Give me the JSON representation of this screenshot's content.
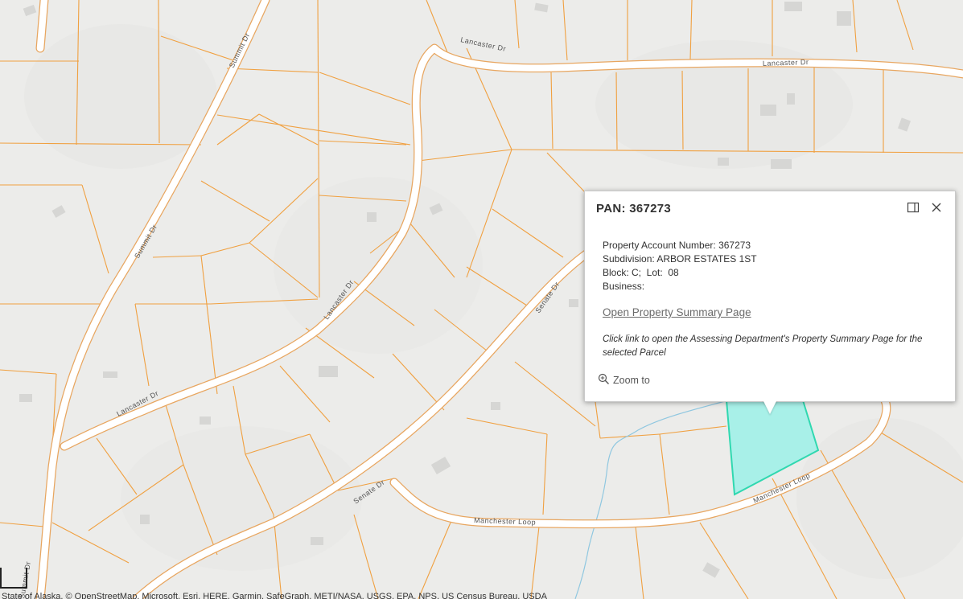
{
  "map": {
    "roads": {
      "summit_dr_upper": "Summit Dr",
      "summit_dr_lower": "Summit Dr",
      "summit_dr_bottom": "Summit Dr",
      "lancaster_dr_top_left": "Lancaster Dr",
      "lancaster_dr_top_right": "Lancaster Dr",
      "lancaster_dr_middle": "Lancaster Dr",
      "lancaster_dr_lower": "Lancaster Dr",
      "senate_dr_upper": "Senate Dr",
      "senate_dr_lower": "Senate Dr",
      "manchester_loop_bottom": "Manchester Loop",
      "manchester_loop_right": "Manchester Loop"
    },
    "colors": {
      "background": "#ececea",
      "parcel_line": "#f0a040",
      "road_fill": "#ffffff",
      "road_casing": "#e8a660",
      "selected_parcel_fill": "#a8f0e8",
      "selected_parcel_stroke": "#30d8b0",
      "stream": "#8fc7e0",
      "building": "#d6d6d4"
    },
    "attribution": "State of Alaska, © OpenStreetMap, Microsoft, Esri, HERE, Garmin, SafeGraph, METI/NASA, USGS, EPA, NPS, US Census Bureau, USDA"
  },
  "popup": {
    "title": "PAN: 367273",
    "fields": {
      "account": "Property Account Number: 367273",
      "subdivision": "Subdivision: ARBOR ESTATES 1ST",
      "block_lot": "Block: C;  Lot:  08",
      "business": "Business:"
    },
    "link_label": "Open Property Summary Page",
    "note": "Click link to open the Assessing Department's Property Summary Page for the selected Parcel",
    "zoom_label": "Zoom to",
    "dock_icon": "dock-icon",
    "close_icon": "close-icon"
  }
}
